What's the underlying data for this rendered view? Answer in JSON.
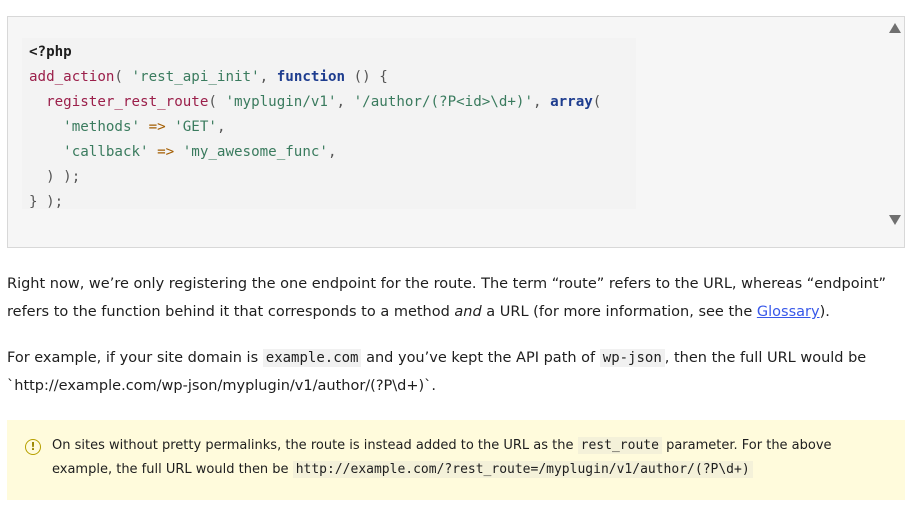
{
  "code_block": {
    "lines": [
      [
        {
          "t": "<?php",
          "c": "plain-bold"
        }
      ],
      [
        {
          "t": "add_action",
          "c": "fn"
        },
        {
          "t": "( ",
          "c": "pn"
        },
        {
          "t": "'rest_api_init'",
          "c": "str"
        },
        {
          "t": ", ",
          "c": "pn"
        },
        {
          "t": "function",
          "c": "kw"
        },
        {
          "t": " () {",
          "c": "pn"
        }
      ],
      [
        {
          "t": "  register_rest_route",
          "c": "fn"
        },
        {
          "t": "( ",
          "c": "pn"
        },
        {
          "t": "'myplugin/v1'",
          "c": "str"
        },
        {
          "t": ", ",
          "c": "pn"
        },
        {
          "t": "'/author/(?P<id>\\d+)'",
          "c": "str"
        },
        {
          "t": ", ",
          "c": "pn"
        },
        {
          "t": "array",
          "c": "kw"
        },
        {
          "t": "(",
          "c": "pn"
        }
      ],
      [
        {
          "t": "    'methods'",
          "c": "str"
        },
        {
          "t": " => ",
          "c": "op"
        },
        {
          "t": "'GET'",
          "c": "str"
        },
        {
          "t": ",",
          "c": "pn"
        }
      ],
      [
        {
          "t": "    'callback'",
          "c": "str"
        },
        {
          "t": " => ",
          "c": "op"
        },
        {
          "t": "'my_awesome_func'",
          "c": "str"
        },
        {
          "t": ",",
          "c": "pn"
        }
      ],
      [
        {
          "t": "  ) );",
          "c": "pn"
        }
      ],
      [
        {
          "t": "} );",
          "c": "pn"
        }
      ]
    ]
  },
  "para1": {
    "part1": "Right now, we’re only registering the one endpoint for the route. The term “route” refers to the URL, whereas “endpoint” refers to the function behind it that corresponds to a method ",
    "em": "and",
    "part2": " a URL (for more information, see the ",
    "link": "Glossary",
    "part3": ")."
  },
  "para2": {
    "part1": "For example, if your site domain is ",
    "code1": "example.com",
    "part2": " and you’ve kept the API path of ",
    "code2": "wp-json",
    "part3": ", then the full URL would be `http://example.com/wp-json/myplugin/v1/author/(?P\\d+)`."
  },
  "notice": {
    "icon": "!",
    "part1": "On sites without pretty permalinks, the route is instead added to the URL as the ",
    "code1": "rest_route",
    "part2": " parameter. For the above example, the full URL would then be ",
    "code2": "http://example.com/?rest_route=/myplugin/v1/author/(?P\\d+)"
  }
}
